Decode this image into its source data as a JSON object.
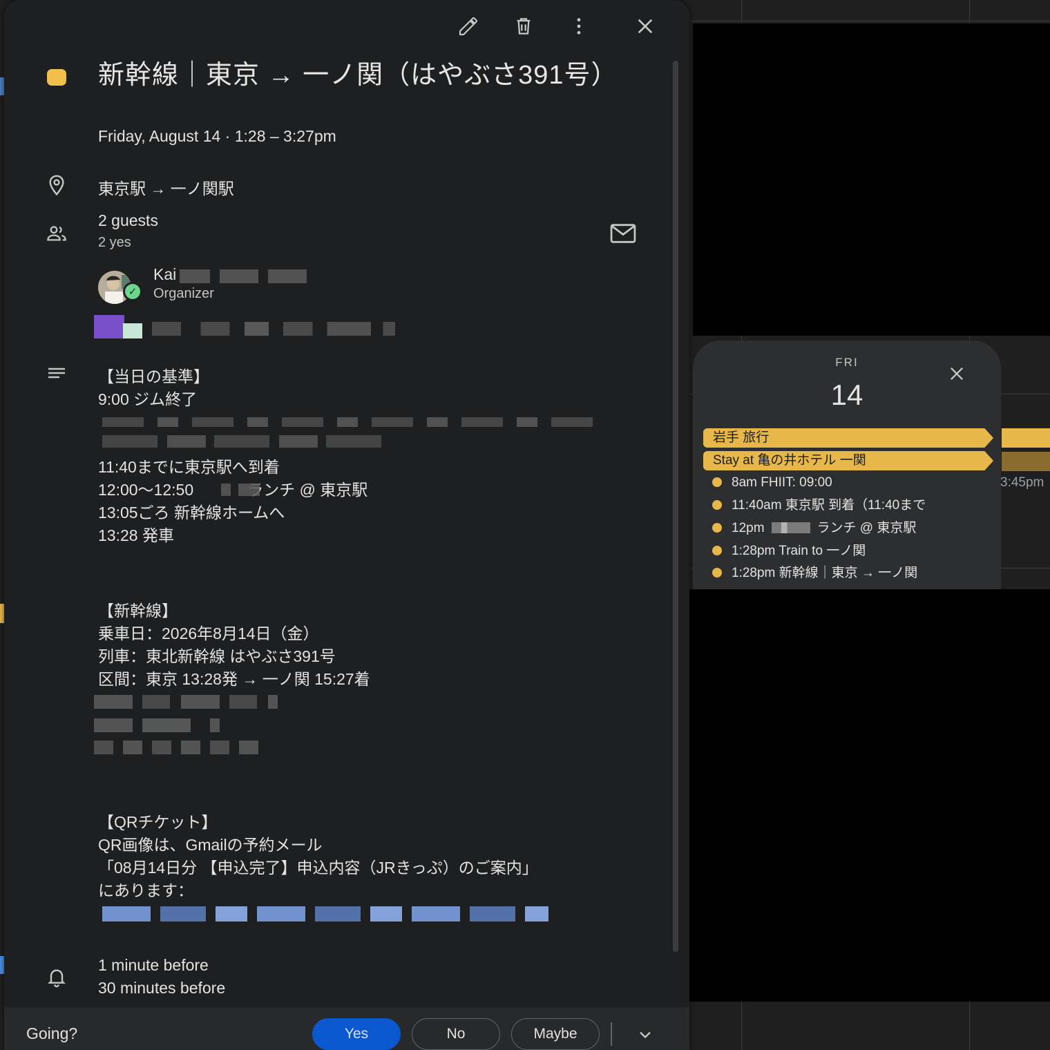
{
  "toolbar": {
    "icons": [
      "edit-icon",
      "delete-icon",
      "more-vert-icon",
      "close-icon"
    ]
  },
  "event": {
    "color": "#f0c04a",
    "title": "新幹線｜東京 → 一ノ関（はやぶさ391号）",
    "datetime": "Friday, August 14  ·  1:28 – 3:27pm",
    "location": "東京駅 → 一ノ関駅",
    "guests_count": "2 guests",
    "guests_yes": "2 yes",
    "organizer_name": "Kai",
    "organizer_role": "Organizer",
    "description": {
      "section1_header": "【当日の基準】",
      "section1_line1": "9:00 ジム終了",
      "section1_line2": "11:40までに東京駅へ到着",
      "section1_line3a": "12:00〜12:50",
      "section1_line3b": "ランチ @ 東京駅",
      "section1_line4": "13:05ごろ 新幹線ホームへ",
      "section1_line5": "13:28 発車",
      "section2_header": "【新幹線】",
      "section2_line1": "乗車日：2026年8月14日（金）",
      "section2_line2": "列車：東北新幹線 はやぶさ391号",
      "section2_line3": "区間：東京 13:28発 → 一ノ関 15:27着",
      "section3_header": "【QRチケット】",
      "section3_line1": "QR画像は、Gmailの予約メール",
      "section3_line2": "「08月14日分 【申込完了】申込内容（JRきっぷ）のご案内」",
      "section3_line3": "にあります："
    },
    "reminders": [
      "1 minute before",
      "30 minutes before"
    ]
  },
  "footer": {
    "going_label": "Going?",
    "yes_label": "Yes",
    "no_label": "No",
    "maybe_label": "Maybe"
  },
  "day_popup": {
    "day_of_week": "FRI",
    "day_number": "14",
    "allday_events": [
      "岩手 旅行",
      "Stay at 亀の井ホテル 一関"
    ],
    "timed_events": [
      "8am FHIIT: 09:00",
      "11:40am 東京駅 到着（11:40まで",
      "12pm",
      "1:28pm Train to 一ノ関",
      "1:28pm 新幹線｜東京 → 一ノ関"
    ],
    "timed_event_3_suffix": "ランチ @ 東京駅",
    "accent_color": "#e7b74a"
  },
  "background": {
    "partial_time": "3:45pm"
  }
}
